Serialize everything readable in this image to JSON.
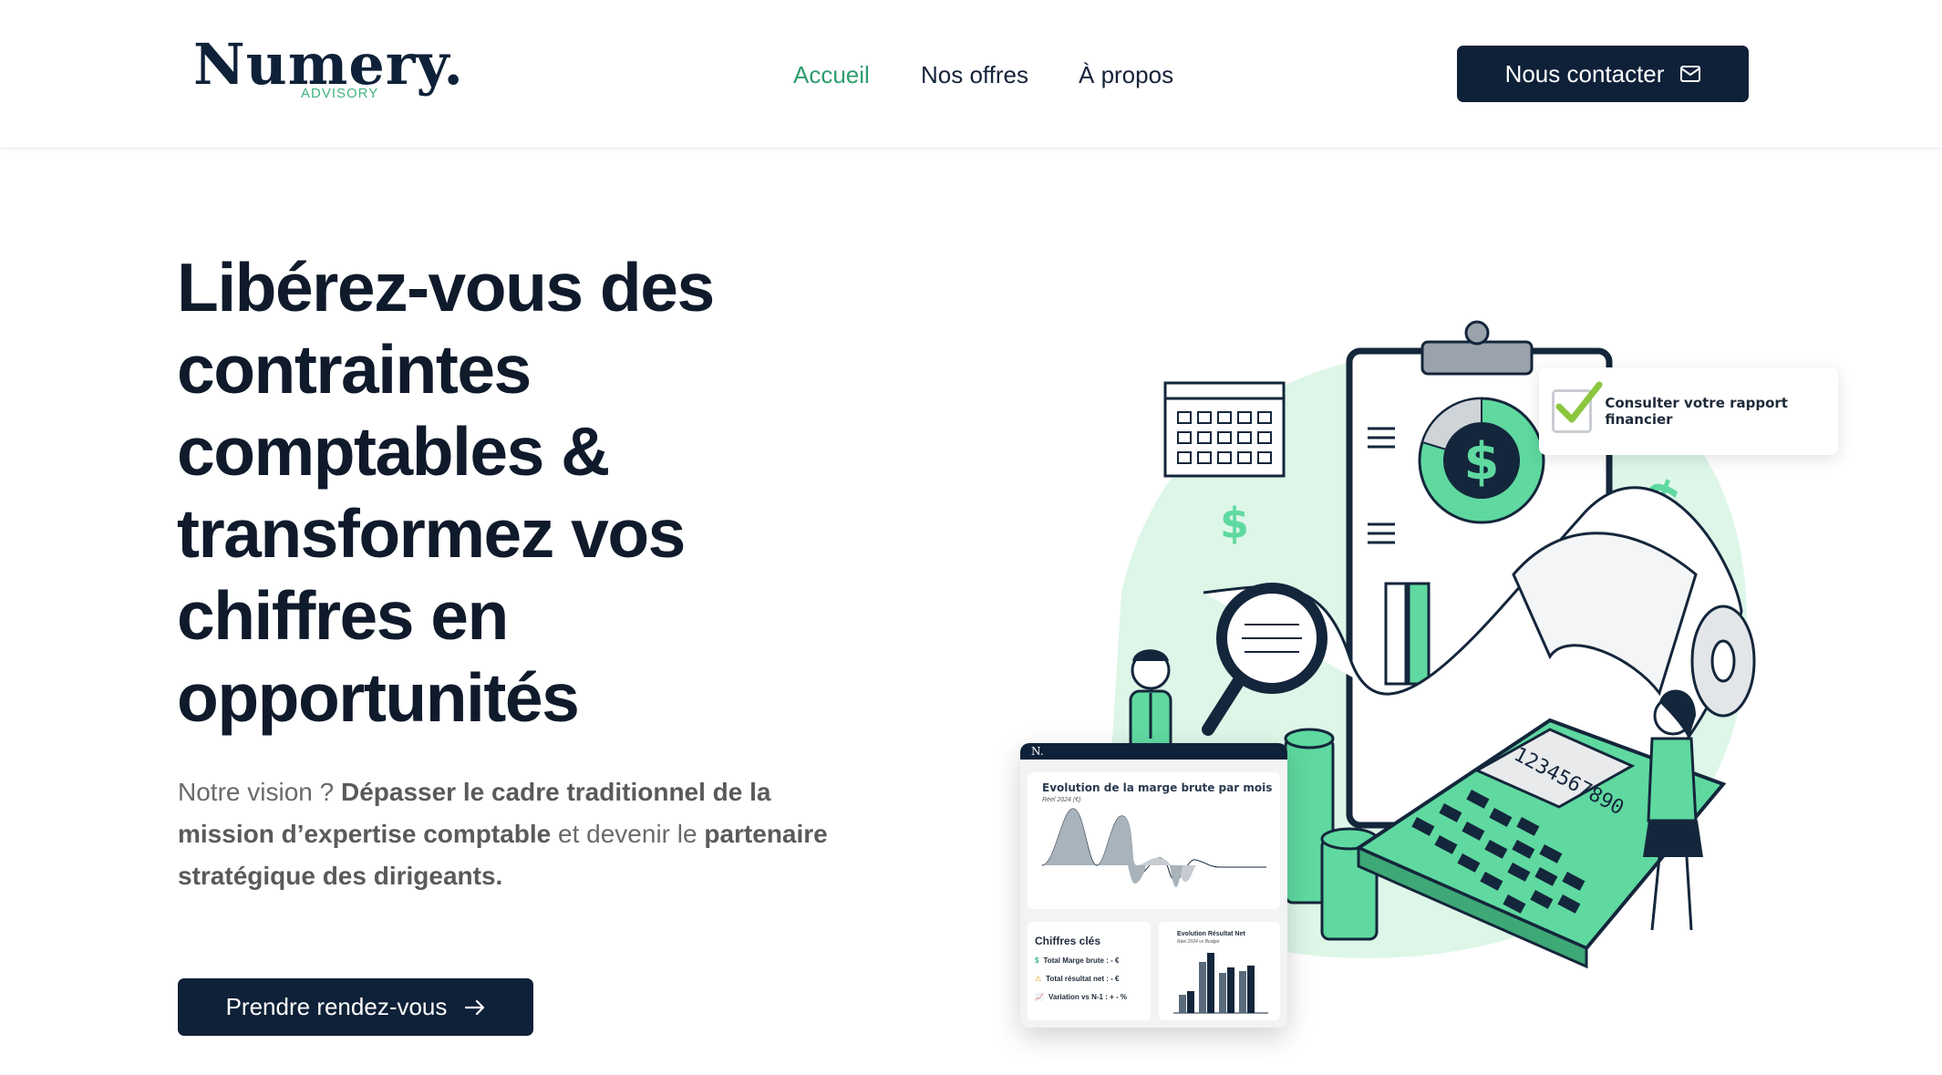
{
  "brand": {
    "name": "Numery.",
    "tagline": "ADVISORY"
  },
  "nav": {
    "items": [
      {
        "label": "Accueil",
        "active": true
      },
      {
        "label": "Nos offres",
        "active": false
      },
      {
        "label": "À propos",
        "active": false
      }
    ],
    "contact_label": "Nous contacter"
  },
  "hero": {
    "title_lines": [
      "Libérez-vous des",
      "contraintes",
      "comptables &",
      "transformez vos",
      "chiffres en",
      "opportunités"
    ],
    "vision_prefix": "Notre vision ? ",
    "vision_bold1": "Dépasser le cadre traditionnel de la mission d’expertise comptable",
    "vision_mid": " et devenir le ",
    "vision_bold2": "partenaire stratégique des dirigeants.",
    "cta_label": "Prendre rendez-vous"
  },
  "illustration": {
    "report_label": "Consulter votre rapport financier",
    "calculator_display": "1234567890",
    "dashboard": {
      "logo": "N.",
      "chart_title": "Evolution de la marge brute par mois",
      "chart_subtitle": "Réel 2024 (€)",
      "kpi_title": "Chiffres clés",
      "kpi_rows": [
        {
          "icon": "$",
          "label": "Total Marge brute : - €"
        },
        {
          "icon": "⚠",
          "label": "Total résultat net : - €"
        },
        {
          "icon": "📈",
          "label": "Variation vs N-1 : + - %"
        }
      ],
      "net_title": "Evolution Résultat Net",
      "net_subtitle": "Réel 2024 vs Budget"
    }
  },
  "colors": {
    "navy": "#0f2138",
    "green": "#2f9c6e",
    "mint": "#5fd9a0",
    "mint_bg": "#ddf6e8"
  }
}
